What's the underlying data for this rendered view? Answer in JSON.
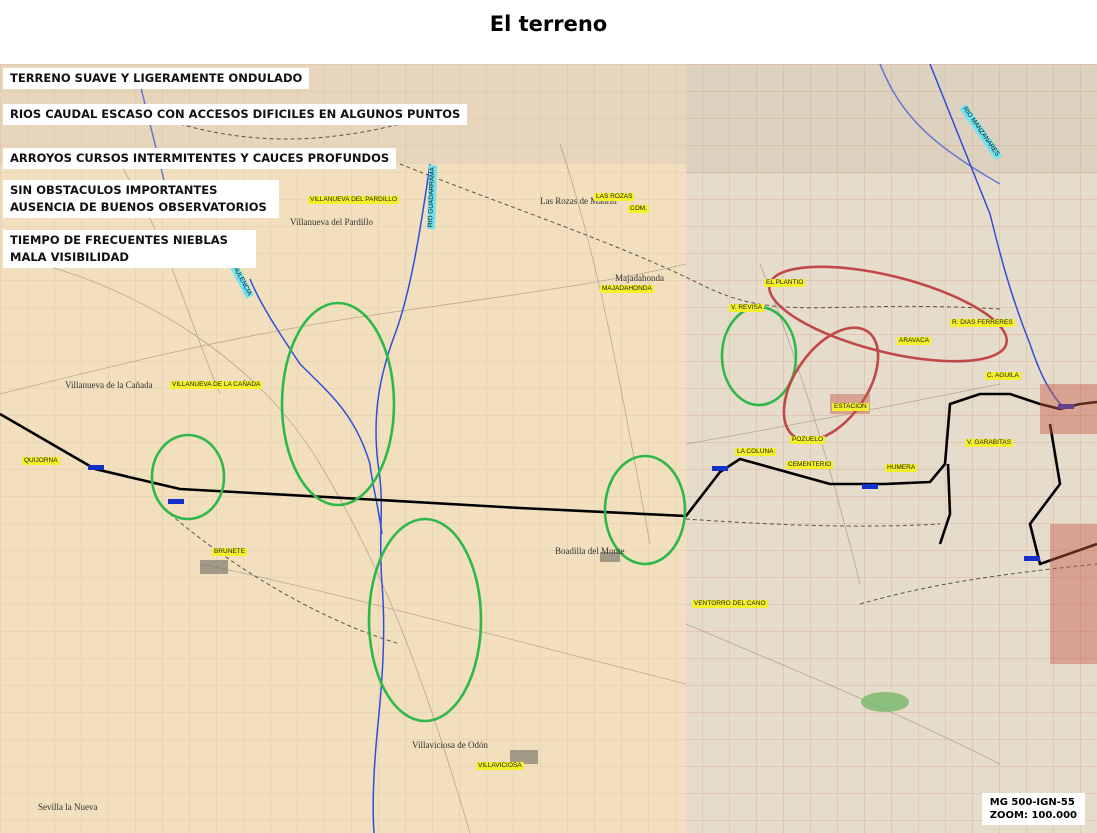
{
  "title": "El terreno",
  "notes": [
    "TERRENO SUAVE Y  LIGERAMENTE ONDULADO",
    "RIOS CAUDAL ESCASO CON ACCESOS DIFICILES EN ALGUNOS PUNTOS",
    "ARROYOS CURSOS INTERMITENTES  Y CAUCES PROFUNDOS",
    [
      "SIN OBSTACULOS IMPORTANTES",
      "AUSENCIA DE BUENOS OBSERVATORIOS"
    ],
    [
      "TIEMPO DE FRECUENTES NIEBLAS",
      "MALA VISIBILIDAD"
    ]
  ],
  "map_ref": {
    "line1": "MG 500-IGN-55",
    "line2": "ZOOM: 100.000"
  },
  "river_labels": [
    "RIO GUADARRAMA",
    "R. AULENCIA",
    "RIO MANZANARES"
  ],
  "place_labels": [
    "VILLANUEVA DEL PARDILLO",
    "LAS ROZAS",
    "COM.",
    "MAJADAHONDA",
    "VILLANUEVA DE LA CAÑADA",
    "QUIJORNA",
    "BRUNETE",
    "VILLAVICIOSA",
    "EL PLANTIO",
    "V. REVISA",
    "ARAVACA",
    "R. DIAS FERRERES",
    "C. AGUILA",
    "ESTACION",
    "POZUELO",
    "LA COLUNA",
    "CEMENTERIO",
    "HUMERA",
    "V. GARABITAS",
    "VENTORRO DEL CANO"
  ],
  "town_names": [
    "Villanueva del Pardillo",
    "Las Rozas de Madrid",
    "Boadilla del Monte",
    "Villaviciosa de Odón",
    "Sevilla la Nueva",
    "Villanueva de la Cañada",
    "Majadahonda"
  ],
  "colors": {
    "front_line": "#000000",
    "rivers": "#2f4fd8",
    "terrain_ellipses": "#2fb84a",
    "urban_ellipses": "#c04848",
    "place_label_bg": "#f3ef2a",
    "river_label_bg": "#6fe3f0"
  }
}
